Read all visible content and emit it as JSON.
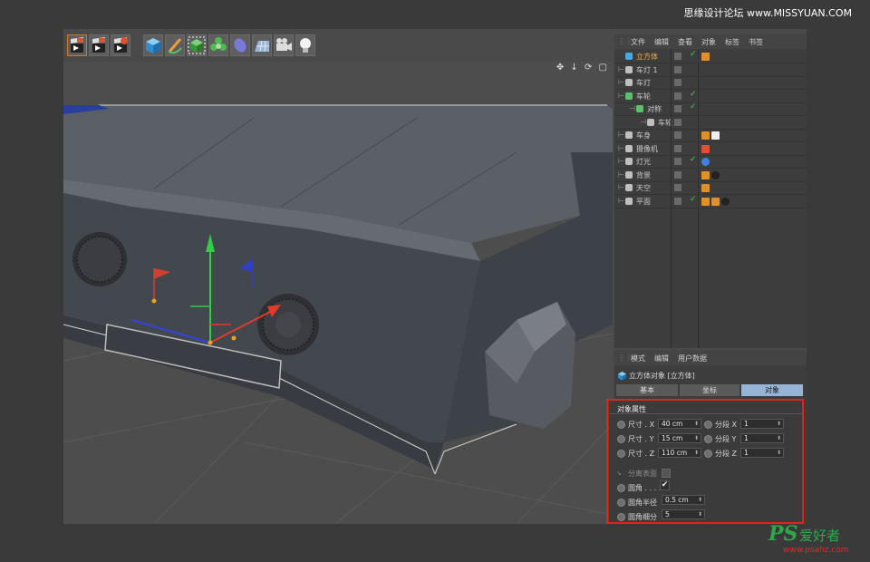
{
  "watermark_top": "思缘设计论坛 www.MISSYUAN.COM",
  "watermark_bottom": {
    "ps": "PS",
    "cn": "爱好者",
    "url": "www.psahz.com"
  },
  "toolbar": {
    "icons": [
      "clapper-render-view-icon",
      "clapper-render-icon",
      "clapper-render-settings-icon",
      "cube-icon",
      "pen-icon",
      "cube-select-icon",
      "nurbs-flower-icon",
      "deformer-bend-icon",
      "floor-grid-icon",
      "camera-icon",
      "light-bulb-icon"
    ]
  },
  "viewport": {
    "nav_icons": "✥ ↓ ⟳ ▢"
  },
  "object_manager": {
    "menu": [
      "文件",
      "编辑",
      "查看",
      "对象",
      "标签",
      "书签"
    ],
    "objects": [
      {
        "name": "立方体",
        "indent": 0,
        "color": "#f0b24a",
        "icon": "cube-icon",
        "check": "✓"
      },
      {
        "name": "车灯 1",
        "indent": 0,
        "color": "#c8c8c8",
        "icon": "null-icon",
        "check": ""
      },
      {
        "name": "车灯",
        "indent": 0,
        "color": "#c8c8c8",
        "icon": "null-icon",
        "check": ""
      },
      {
        "name": "车轮",
        "indent": 0,
        "color": "#c8c8c8",
        "icon": "sphere-icon",
        "check": "✓"
      },
      {
        "name": "对称",
        "indent": 1,
        "color": "#c8c8c8",
        "icon": "symmetry-icon",
        "check": "✓"
      },
      {
        "name": "车轮",
        "indent": 2,
        "color": "#c8c8c8",
        "icon": "null-icon",
        "check": ""
      },
      {
        "name": "车身",
        "indent": 0,
        "color": "#c8c8c8",
        "icon": "body-icon",
        "check": ""
      },
      {
        "name": "摄像机",
        "indent": 0,
        "color": "#c8c8c8",
        "icon": "camera-icon",
        "check": ""
      },
      {
        "name": "灯光",
        "indent": 0,
        "color": "#c8c8c8",
        "icon": "light-icon",
        "check": "✓"
      },
      {
        "name": "背景",
        "indent": 0,
        "color": "#c8c8c8",
        "icon": "background-icon",
        "check": ""
      },
      {
        "name": "天空",
        "indent": 0,
        "color": "#c8c8c8",
        "icon": "sky-icon",
        "check": ""
      },
      {
        "name": "平面",
        "indent": 0,
        "color": "#c8c8c8",
        "icon": "plane-icon",
        "check": "✓"
      }
    ]
  },
  "attribute_manager": {
    "menu": [
      "模式",
      "编辑",
      "用户数据"
    ],
    "object_title": "立方体对象 [立方体]",
    "tabs": [
      "基本",
      "坐标",
      "对象"
    ],
    "active_tab": "对象",
    "section_title": "对象属性",
    "size_x_label": "尺寸 . X",
    "size_x": "40 cm",
    "size_y_label": "尺寸 . Y",
    "size_y": "15 cm",
    "size_z_label": "尺寸 . Z",
    "size_z": "110 cm",
    "seg_x_label": "分段 X",
    "seg_x": "1",
    "seg_y_label": "分段 Y",
    "seg_y": "1",
    "seg_z_label": "分段 Z",
    "seg_z": "1",
    "separate_label": "分离表面",
    "fillet_label": "圆角 . . . .",
    "fillet_check": "✔",
    "fillet_radius_label": "圆角半径",
    "fillet_radius": "0.5 cm",
    "fillet_sub_label": "圆角细分",
    "fillet_sub": "5"
  },
  "colors": {
    "accent_red": "#e0241c",
    "active_tab": "#96b4d6",
    "check_green": "#3cd04a",
    "object_selected": "#f0b24a"
  }
}
